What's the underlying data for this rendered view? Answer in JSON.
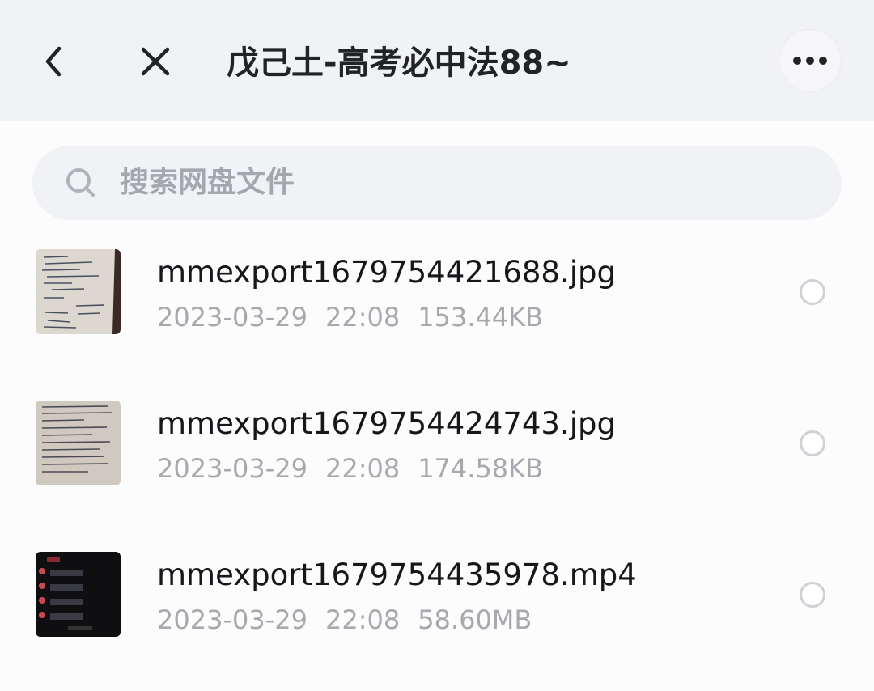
{
  "header": {
    "title": "戊己土-高考必中法88~",
    "back_icon": "chevron-left-icon",
    "close_icon": "close-icon",
    "more_icon": "more-dots-icon"
  },
  "search": {
    "placeholder": "搜索网盘文件",
    "icon": "search-icon"
  },
  "files": [
    {
      "name": "mmexport1679754421688.jpg",
      "date": "2023-03-29",
      "time": "22:08",
      "size": "153.44KB",
      "type": "image"
    },
    {
      "name": "mmexport1679754424743.jpg",
      "date": "2023-03-29",
      "time": "22:08",
      "size": "174.58KB",
      "type": "image"
    },
    {
      "name": "mmexport1679754435978.mp4",
      "date": "2023-03-29",
      "time": "22:08",
      "size": "58.60MB",
      "type": "video"
    }
  ],
  "colors": {
    "header_bg": "#f1f2f6",
    "text_primary": "#16171a",
    "text_secondary": "#a7a9ae"
  }
}
